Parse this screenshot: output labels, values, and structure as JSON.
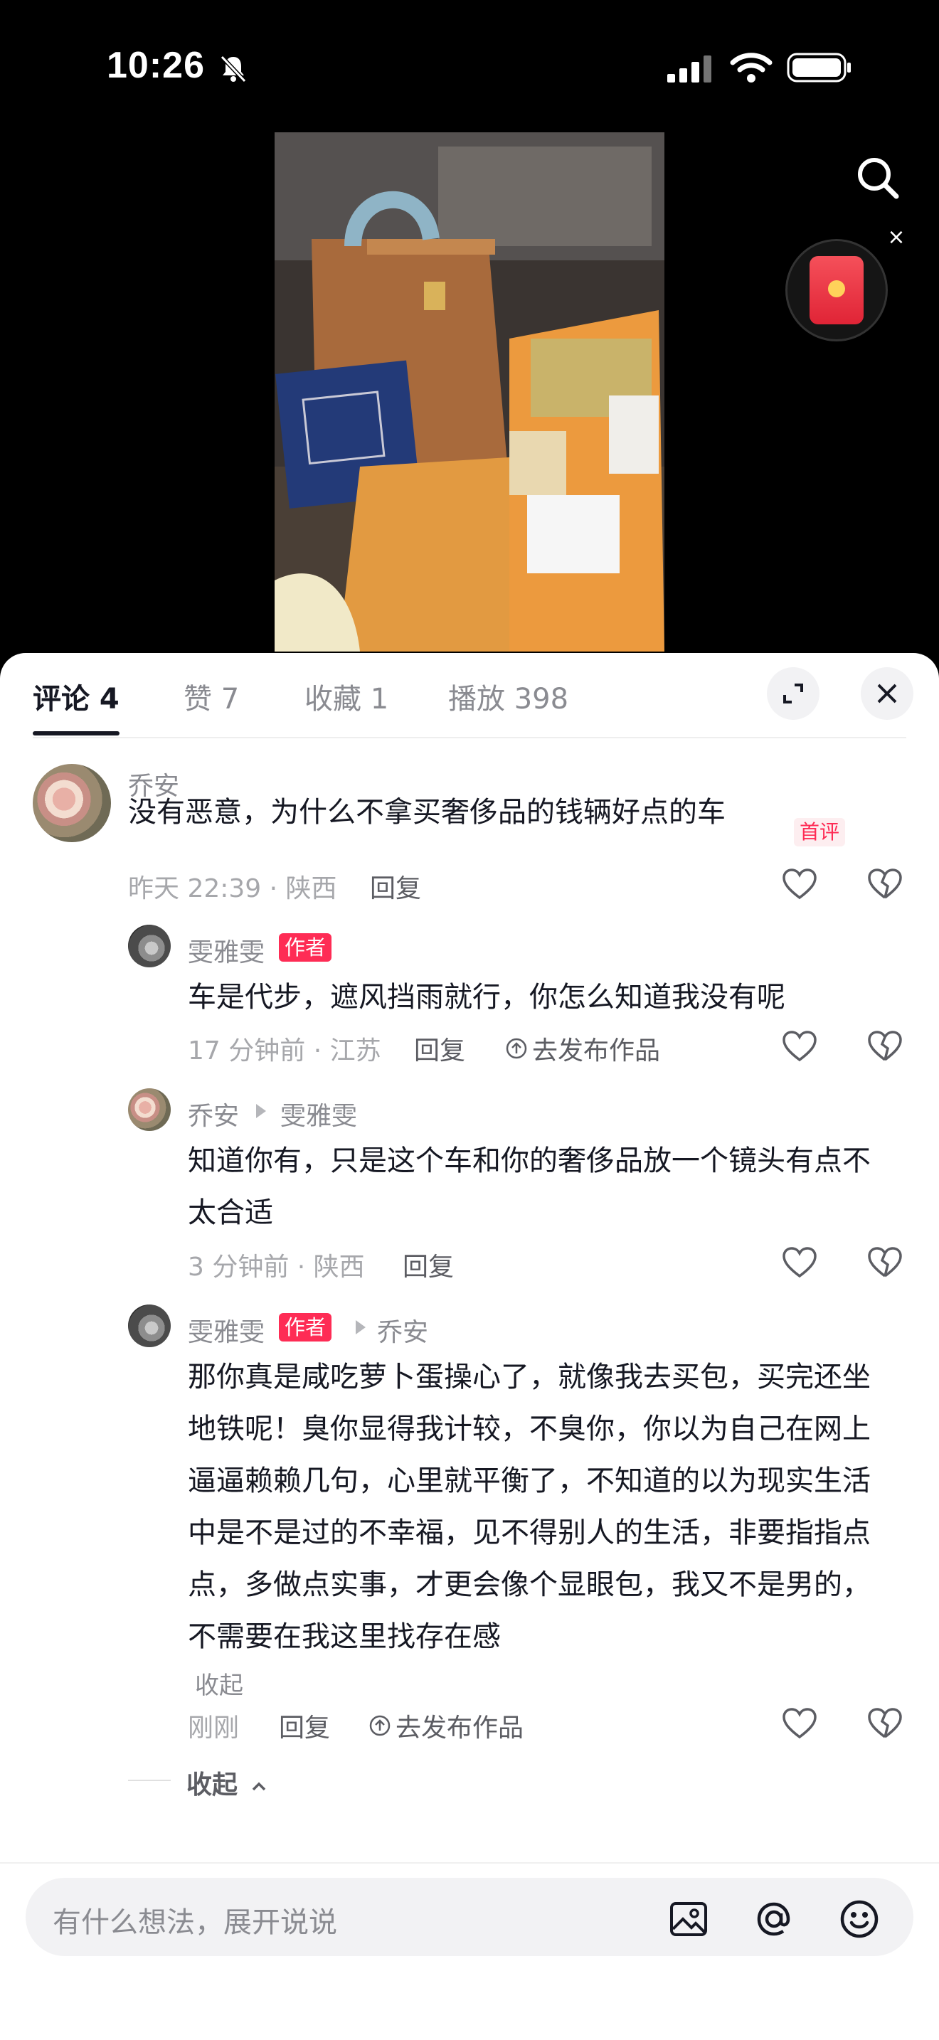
{
  "status_bar": {
    "time": "10:26"
  },
  "tabs": {
    "comments": "评论 4",
    "likes": "赞 7",
    "favorites": "收藏 1",
    "plays": "播放 398"
  },
  "comments": [
    {
      "user": "乔安",
      "badge_first": "首评",
      "text": "没有恶意，为什么不拿买奢侈品的钱辆好点的车",
      "meta": "昨天 22:39 · 陕西",
      "reply": "回复"
    },
    {
      "user": "雯雅雯",
      "badge_author": "作者",
      "text": "车是代步，遮风挡雨就行，你怎么知道我没有呢",
      "meta": "17 分钟前 · 江苏",
      "reply": "回复",
      "publish": "去发布作品"
    },
    {
      "user": "乔安",
      "reply_to": "雯雅雯",
      "text": "知道你有，只是这个车和你的奢侈品放一个镜头有点不太合适",
      "meta": "3 分钟前 · 陕西",
      "reply": "回复"
    },
    {
      "user": "雯雅雯",
      "badge_author": "作者",
      "reply_to": "乔安",
      "text": "那你真是咸吃萝卜蛋操心了，就像我去买包，买完还坐地铁呢！臭你显得我计较，不臭你，你以为自己在网上逼逼赖赖几句，心里就平衡了，不知道的以为现实生活中是不是过的不幸福，见不得别人的生活，非要指指点点，多做点实事，才更会像个显眼包，我又不是男的，不需要在我这里找存在感",
      "fold": "收起",
      "meta": "刚刚",
      "reply": "回复",
      "publish": "去发布作品"
    }
  ],
  "collapse_label": "收起",
  "input": {
    "placeholder": "有什么想法，展开说说"
  },
  "colors": {
    "accent": "#fe2c55",
    "text": "#161823",
    "muted": "#8a8b91"
  },
  "icons": [
    "bell-slash-icon",
    "signal-icon",
    "wifi-icon",
    "battery-icon",
    "search-icon",
    "red-packet-icon",
    "expand-icon",
    "close-icon",
    "heart-icon",
    "broken-heart-icon",
    "image-icon",
    "at-icon",
    "emoji-icon"
  ]
}
